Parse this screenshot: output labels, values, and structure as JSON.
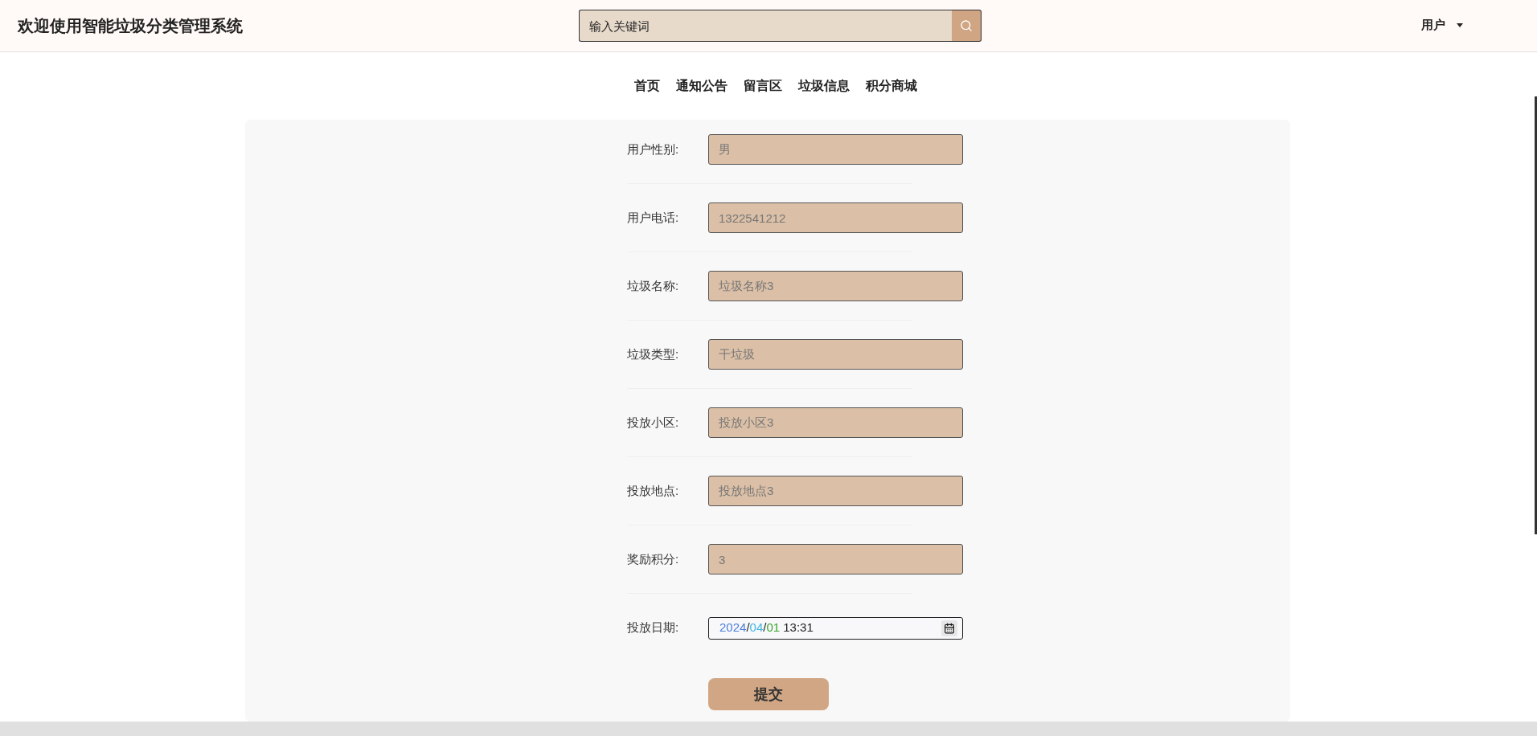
{
  "header": {
    "title": "欢迎使用智能垃圾分类管理系统",
    "search": {
      "placeholder": "输入关键词"
    },
    "user_menu": {
      "label": "用户"
    }
  },
  "nav": [
    {
      "label": "首页"
    },
    {
      "label": "通知公告"
    },
    {
      "label": "留言区"
    },
    {
      "label": "垃圾信息"
    },
    {
      "label": "积分商城"
    }
  ],
  "form": {
    "fields": [
      {
        "kind": "text",
        "label": "用户性别:",
        "value": "男"
      },
      {
        "kind": "text",
        "label": "用户电话:",
        "value": "1322541212"
      },
      {
        "kind": "text",
        "label": "垃圾名称:",
        "value": "垃圾名称3"
      },
      {
        "kind": "text",
        "label": "垃圾类型:",
        "value": "干垃圾"
      },
      {
        "kind": "text",
        "label": "投放小区:",
        "value": "投放小区3"
      },
      {
        "kind": "text",
        "label": "投放地点:",
        "value": "投放地点3"
      },
      {
        "kind": "text",
        "label": "奖励积分:",
        "value": "3"
      },
      {
        "kind": "date",
        "label": "投放日期:",
        "segments": [
          {
            "text": "2024",
            "color": "#4a7fd8"
          },
          {
            "text": "/",
            "color": "#222222"
          },
          {
            "text": "04",
            "color": "#3fb6e0"
          },
          {
            "text": "/",
            "color": "#222222"
          },
          {
            "text": "01",
            "color": "#3aa52a"
          },
          {
            "text": " 13:31",
            "color": "#222222"
          }
        ]
      }
    ],
    "submit": "提交"
  }
}
